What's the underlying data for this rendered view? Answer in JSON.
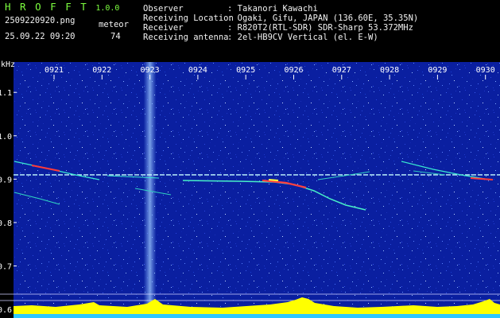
{
  "header": {
    "app_name": "H R O F F T",
    "version": "1.0.0",
    "filename": "2509220920.png",
    "count_label": "meteor",
    "timestamp": "25.09.22 09:20",
    "count_value": "74",
    "info": [
      {
        "label": "Observer",
        "value": ": Takanori Kawachi"
      },
      {
        "label": "Receiving Location",
        "value": ": Ogaki, Gifu, JAPAN (136.60E, 35.35N)"
      },
      {
        "label": "Receiver",
        "value": ": R820T2(RTL-SDR) SDR-Sharp 53.372MHz"
      },
      {
        "label": "Receiving antenna",
        "value": ": 2el-HB9CV Vertical (el. E-W)"
      }
    ]
  },
  "colors": {
    "background_noise": "#0a1fa0",
    "carrier": "#c8ffff",
    "meteor": "#ff3030",
    "trace": "#30ffd0",
    "histogram": "#ffff00",
    "header_green": "#7dff3f"
  },
  "chart_data": {
    "type": "heatmap",
    "ylabel": "kHz",
    "x_ticks": [
      "0921",
      "0922",
      "0923",
      "0924",
      "0925",
      "0926",
      "0927",
      "0928",
      "0929",
      "0930"
    ],
    "y_ticks": [
      "1.1",
      "1.0",
      "0.9",
      "0.8",
      "0.7",
      "0.6"
    ],
    "ylim": [
      0.58,
      1.17
    ],
    "carrier_khz": 0.91,
    "interference_minute": 9.23
  }
}
